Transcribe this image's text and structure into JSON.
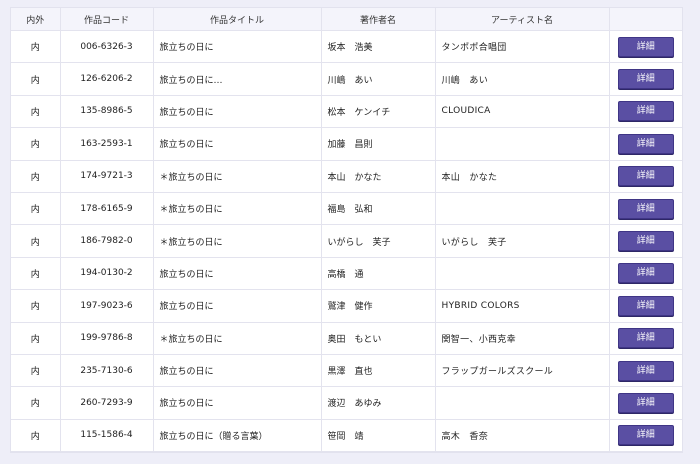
{
  "table": {
    "headers": {
      "inout": "内外",
      "code": "作品コード",
      "title": "作品タイトル",
      "author": "著作者名",
      "artist": "アーティスト名",
      "action": ""
    },
    "button_label": "詳細",
    "rows": [
      {
        "inout": "内",
        "code": "006-6326-3",
        "title": "旅立ちの日に",
        "author": "坂本　浩美",
        "artist": "タンポポ合唱団"
      },
      {
        "inout": "内",
        "code": "126-6206-2",
        "title": "旅立ちの日に…",
        "author": "川嶋　あい",
        "artist": "川嶋　あい"
      },
      {
        "inout": "内",
        "code": "135-8986-5",
        "title": "旅立ちの日に",
        "author": "松本　ケンイチ",
        "artist": "CLOUDICA"
      },
      {
        "inout": "内",
        "code": "163-2593-1",
        "title": "旅立ちの日に",
        "author": "加藤　昌則",
        "artist": ""
      },
      {
        "inout": "内",
        "code": "174-9721-3",
        "title": "＊旅立ちの日に",
        "author": "本山　かなた",
        "artist": "本山　かなた"
      },
      {
        "inout": "内",
        "code": "178-6165-9",
        "title": "＊旅立ちの日に",
        "author": "福島　弘和",
        "artist": ""
      },
      {
        "inout": "内",
        "code": "186-7982-0",
        "title": "＊旅立ちの日に",
        "author": "いがらし　芙子",
        "artist": "いがらし　芙子"
      },
      {
        "inout": "内",
        "code": "194-0130-2",
        "title": "旅立ちの日に",
        "author": "高橋　通",
        "artist": ""
      },
      {
        "inout": "内",
        "code": "197-9023-6",
        "title": "旅立ちの日に",
        "author": "鷲津　健作",
        "artist": "HYBRID COLORS"
      },
      {
        "inout": "内",
        "code": "199-9786-8",
        "title": "＊旅立ちの日に",
        "author": "奥田　もとい",
        "artist": "関智一、小西克幸"
      },
      {
        "inout": "内",
        "code": "235-7130-6",
        "title": "旅立ちの日に",
        "author": "黒澤　直也",
        "artist": "フラップガールズスクール"
      },
      {
        "inout": "内",
        "code": "260-7293-9",
        "title": "旅立ちの日に",
        "author": "渡辺　あゆみ",
        "artist": ""
      },
      {
        "inout": "内",
        "code": "115-1586-4",
        "title": "旅立ちの日に（贈る言葉）",
        "author": "笹岡　靖",
        "artist": "高木　香奈"
      }
    ]
  },
  "colors": {
    "page_background": "#eeeef8",
    "button": "#5a4fa3",
    "header_background": "#f4f4fb"
  }
}
